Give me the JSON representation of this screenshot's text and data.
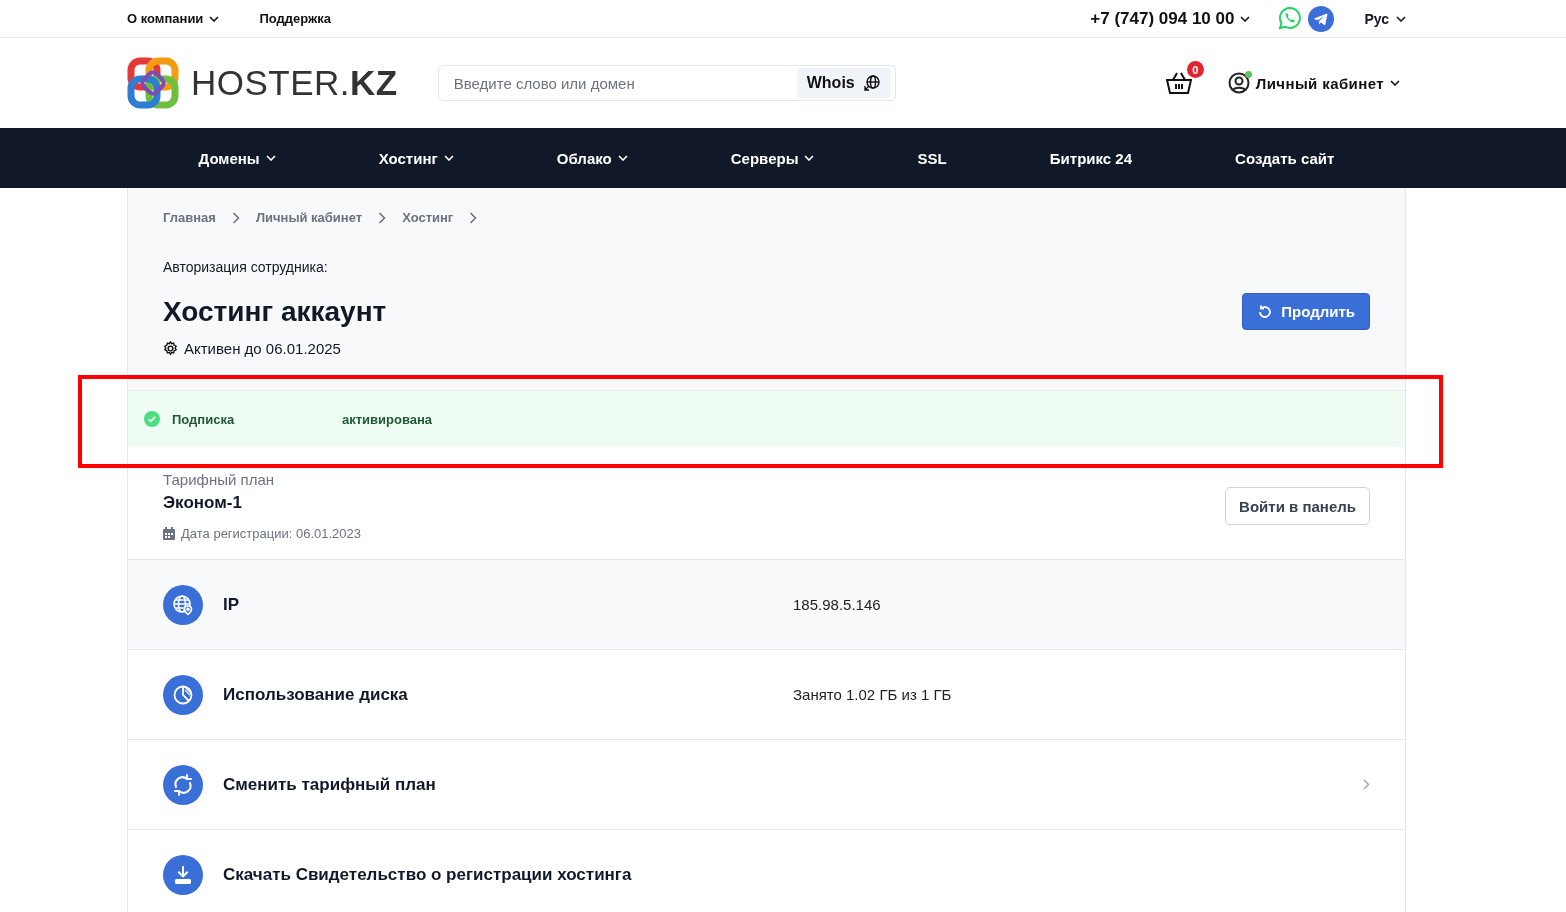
{
  "top_bar": {
    "links": [
      {
        "label": "О компании",
        "dropdown": true
      },
      {
        "label": "Поддержка",
        "dropdown": false
      }
    ],
    "phone": "+7 (747) 094 10 00",
    "language": "Рус"
  },
  "header": {
    "logo_text": "HOSTER.**KZ**",
    "search": {
      "placeholder": "Введите слово или домен",
      "button": "Whois"
    },
    "cart_count": "0",
    "account": {
      "label": "Личный кабинет",
      "online": true
    }
  },
  "nav": [
    {
      "label": "Домены",
      "dropdown": true
    },
    {
      "label": "Хостинг",
      "dropdown": true
    },
    {
      "label": "Облако",
      "dropdown": true
    },
    {
      "label": "Серверы",
      "dropdown": true
    },
    {
      "label": "SSL",
      "dropdown": false
    },
    {
      "label": "Битрикс 24",
      "dropdown": false
    },
    {
      "label": "Создать сайт",
      "dropdown": false
    }
  ],
  "breadcrumbs": [
    "Главная",
    "Личный кабинет",
    "Хостинг"
  ],
  "auth_label": "Авторизация сотрудника:",
  "title": "Хостинг аккаунт",
  "status": "Активен до 06.01.2025",
  "renew_button": "Продлить",
  "subscription": {
    "label": "Подписка",
    "value": "активирована",
    "highlighted": true
  },
  "plan": {
    "label": "Тарифный план",
    "name": "Эконом-1",
    "registered": "Дата регистрации: 06.01.2023",
    "panel_button": "Войти в панель"
  },
  "rows": [
    {
      "kind": "value",
      "title": "IP",
      "value": "185.98.5.146"
    },
    {
      "kind": "value",
      "title": "Использование диска",
      "value": "Занято 1.02 ГБ из 1 ГБ"
    },
    {
      "kind": "link",
      "title": "Сменить тарифный план"
    },
    {
      "kind": "action",
      "title": "Скачать Свидетельство о регистрации хостинга"
    }
  ]
}
